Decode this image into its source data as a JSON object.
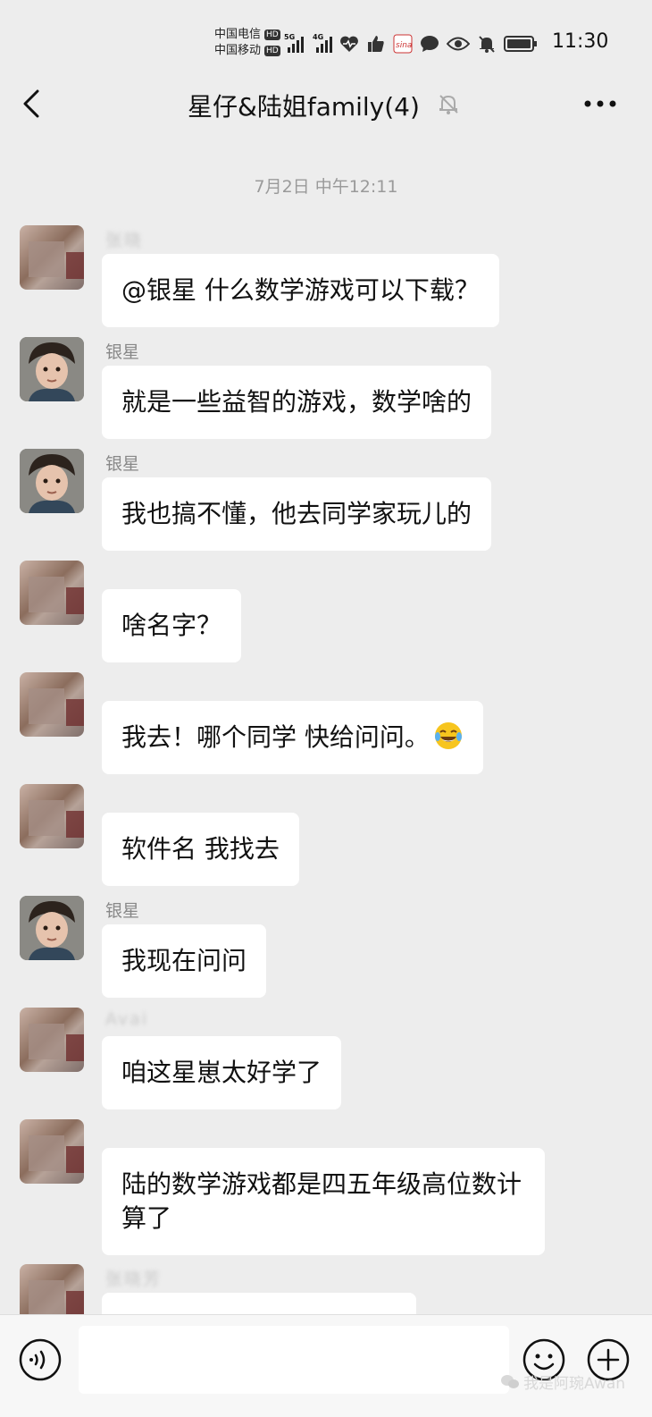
{
  "status_bar": {
    "carrier_1": "中国电信",
    "carrier_2": "中国移动",
    "hd_badge": "HD",
    "network_5g": "5G",
    "network_4g": "4G",
    "time": "11:30"
  },
  "nav": {
    "title": "星仔&陆姐family(4)"
  },
  "chat": {
    "timestamp": "7月2日 中午12:11",
    "messages": [
      {
        "sender": "张晓",
        "text": "@银星  什么数学游戏可以下载？"
      },
      {
        "sender": "银星",
        "text": "就是一些益智的游戏，数学啥的"
      },
      {
        "sender": "银星",
        "text": "我也搞不懂，他去同学家玩儿的"
      },
      {
        "sender": "",
        "text": "啥名字？"
      },
      {
        "sender": "",
        "text": "我去！哪个同学 快给问问。"
      },
      {
        "sender": "",
        "text": "软件名 我找去"
      },
      {
        "sender": "银星",
        "text": "我现在问问"
      },
      {
        "sender": "Avai",
        "text": "咱这星崽太好学了"
      },
      {
        "sender": "",
        "text": "陆的数学游戏都是四五年级高位数计算了"
      },
      {
        "sender": "张晓芳",
        "text": ""
      }
    ]
  },
  "input": {
    "watermark": "我是阿琬Awan"
  },
  "icons": {
    "back": "chevron-left-icon",
    "mute": "bell-off-icon",
    "more": "more-dots-icon",
    "voice": "voice-icon",
    "emoji": "emoji-icon",
    "plus": "plus-icon",
    "laugh": "laugh-cry-emoji"
  }
}
